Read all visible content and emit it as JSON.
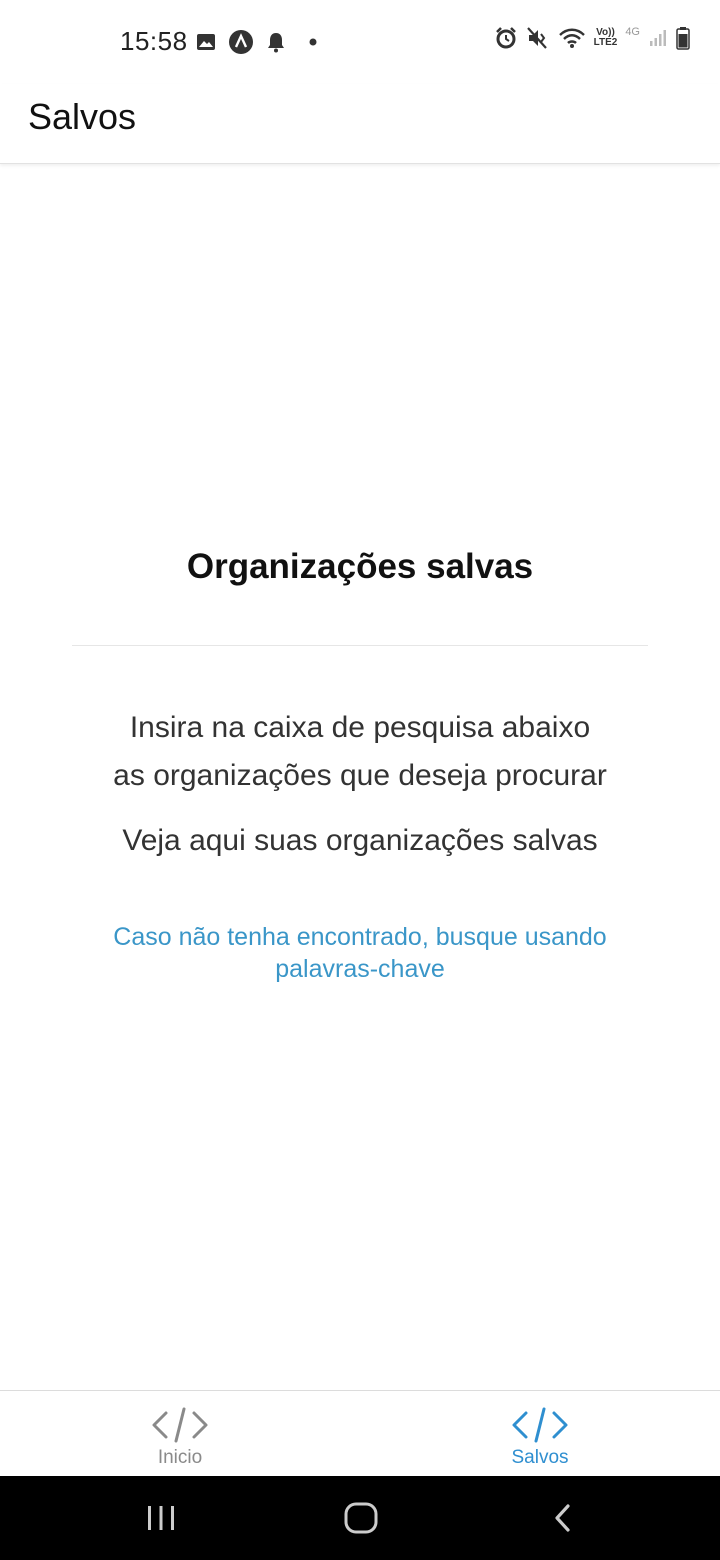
{
  "status_bar": {
    "time": "15:58",
    "left_icons": [
      "image-icon",
      "app-icon",
      "bell-icon",
      "dot-icon"
    ],
    "right_icons": [
      "alarm-icon",
      "mute-icon",
      "wifi-icon",
      "volte-icon",
      "signal-icon",
      "battery-icon"
    ],
    "volte_top": "Vo))",
    "volte_bottom": "LTE2",
    "network": "4G"
  },
  "app_bar": {
    "title": "Salvos"
  },
  "main": {
    "title": "Organizações salvas",
    "instruction_line1": "Insira na caixa de pesquisa abaixo",
    "instruction_line2": "as organizações que deseja procurar",
    "subtext": "Veja aqui suas organizações salvas",
    "hint_line1": "Caso não tenha encontrado, busque usando",
    "hint_line2": "palavras-chave"
  },
  "tabs": [
    {
      "label": "Inicio",
      "icon": "code-icon",
      "active": false
    },
    {
      "label": "Salvos",
      "icon": "code-icon",
      "active": true
    }
  ],
  "colors": {
    "accent": "#2f8fd0",
    "link": "#3a96c8",
    "inactive": "#8a8a8a"
  },
  "nav_bar": {
    "buttons": [
      "recents-icon",
      "home-icon",
      "back-icon"
    ]
  }
}
